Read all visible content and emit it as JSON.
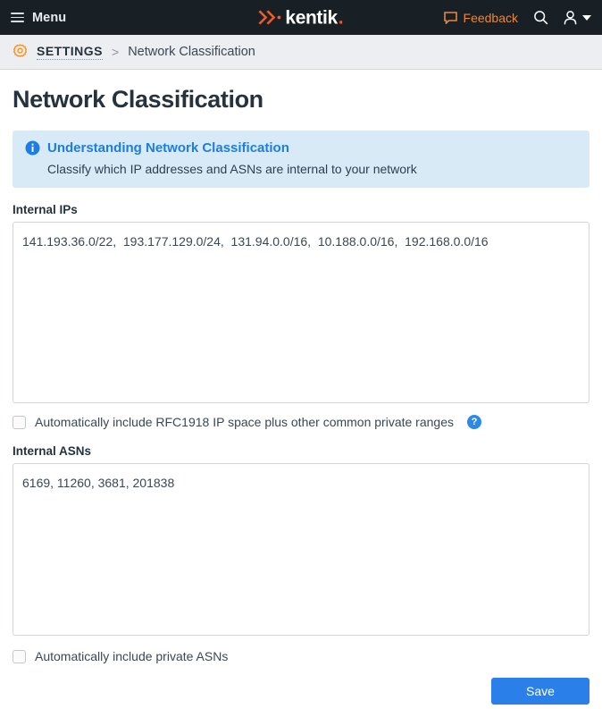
{
  "topbar": {
    "menu_label": "Menu",
    "brand_text": "kentik",
    "brand_punct": ".",
    "feedback_label": "Feedback",
    "icons": {
      "hamburger": "hamburger-icon",
      "feedback": "speech-bubble-icon",
      "search": "search-icon",
      "user": "user-icon",
      "caret": "chevron-down-icon"
    }
  },
  "breadcrumb": {
    "gear_icon": "gear-icon",
    "root_label": "SETTINGS",
    "separator": ">",
    "current_label": "Network Classification"
  },
  "page": {
    "title": "Network Classification"
  },
  "callout": {
    "icon": "info-icon",
    "title": "Understanding Network Classification",
    "body": "Classify which IP addresses and ASNs are internal to your network"
  },
  "internal_ips": {
    "label": "Internal IPs",
    "value": "141.193.36.0/22,  193.177.129.0/24,  131.94.0.0/16,  10.188.0.0/16,  192.168.0.0/16",
    "placeholder": "",
    "entries": [
      "141.193.36.0/22",
      "193.177.129.0/24",
      "131.94.0.0/16",
      "10.188.0.0/16",
      "192.168.0.0/16"
    ],
    "auto_include": {
      "label": "Automatically include RFC1918 IP space plus other common private ranges",
      "checked": false,
      "help_icon": "help-circle-icon",
      "help_glyph": "?"
    }
  },
  "internal_asns": {
    "label": "Internal ASNs",
    "value": "6169, 11260, 3681, 201838",
    "placeholder": "",
    "entries": [
      "6169",
      "11260",
      "3681",
      "201838"
    ],
    "auto_include": {
      "label": "Automatically include private ASNs",
      "checked": false
    }
  },
  "actions": {
    "save_label": "Save"
  },
  "colors": {
    "topbar_bg": "#182026",
    "brand_orange": "#f05a28",
    "feedback_orange": "#e8873c",
    "breadcrumb_bg": "#edeef2",
    "callout_bg": "#d9eaf7",
    "callout_blue": "#1a7fe0",
    "primary_blue": "#2b7fe8",
    "text_dark": "#26323d"
  }
}
